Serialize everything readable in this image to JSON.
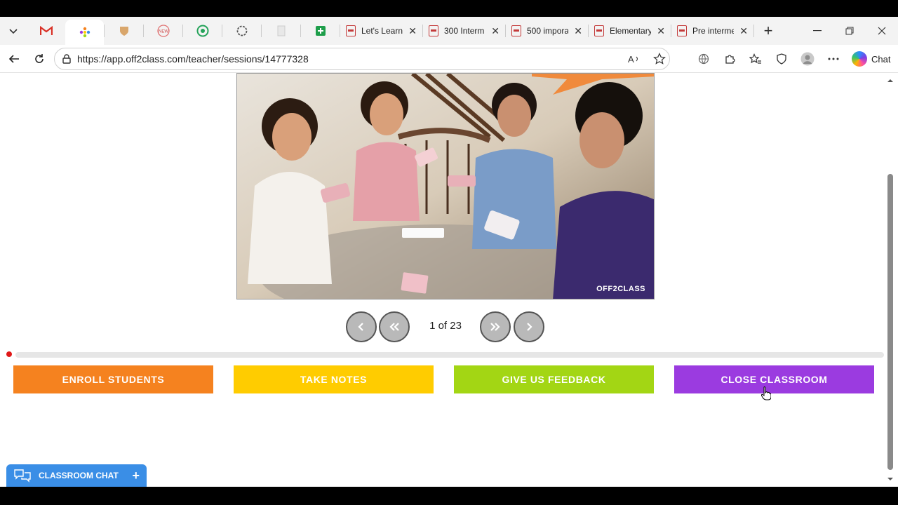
{
  "browser": {
    "tabs": [
      {
        "title": "Let's Learn",
        "close": "✕"
      },
      {
        "title": "300 Interm",
        "close": "✕"
      },
      {
        "title": "500 impora",
        "close": "✕"
      },
      {
        "title": "Elementary",
        "close": "✕"
      },
      {
        "title": "Pre interme",
        "close": "✕"
      }
    ],
    "new_tab": "+",
    "address_url": "https://app.off2class.com/teacher/sessions/14777328",
    "chat_label": "Chat"
  },
  "lesson": {
    "image_watermark": "OFF2CLASS",
    "page_indicator": "1 of 23",
    "progress": 0.0
  },
  "actions": {
    "enroll": "ENROLL STUDENTS",
    "notes": "TAKE NOTES",
    "feedback": "GIVE US FEEDBACK",
    "close": "CLOSE CLASSROOM"
  },
  "colors": {
    "enroll": "#f5821f",
    "notes": "#ffcc00",
    "feedback": "#a3d614",
    "close": "#9b3be0",
    "chat": "#3a8ee6"
  },
  "chat": {
    "label": "CLASSROOM CHAT",
    "add": "+"
  }
}
